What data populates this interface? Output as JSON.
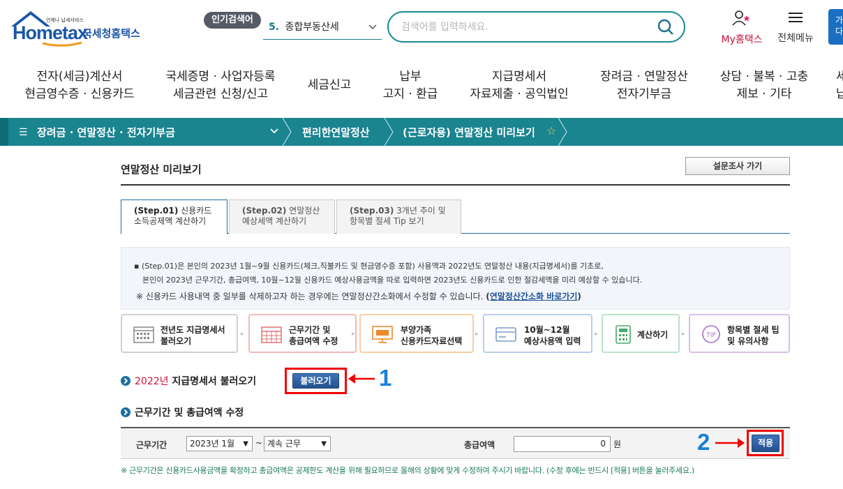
{
  "header": {
    "logo_small": "언제나 납세서비스",
    "logo_brand": "Hometax",
    "logo_kname": "국세청홈택스",
    "popular_badge": "인기검색어",
    "popular_num": "5.",
    "popular_text": "종합부동산세",
    "search_placeholder": "검색어를 입력하세요.",
    "my_hometax": "My홈택스",
    "all_menu": "전체메뉴",
    "right_btn_l1": "가",
    "right_btn_l2": "다"
  },
  "gnb": [
    {
      "l1": "전자(세금)계산서",
      "l2": "현금영수증 · 신용카드"
    },
    {
      "l1": "국세증명 · 사업자등록",
      "l2": "세금관련 신청/신고"
    },
    {
      "l1": "세금신고",
      "l2": ""
    },
    {
      "l1": "납부",
      "l2": "고지 · 환급"
    },
    {
      "l1": "지급명세서",
      "l2": "자료제출 · 공익법인"
    },
    {
      "l1": "장려금 · 연말정산",
      "l2": "전자기부금"
    },
    {
      "l1": "상담 · 불복 · 고충",
      "l2": "제보 · 기타"
    },
    {
      "l1": "세",
      "l2": "납"
    }
  ],
  "breadcrumb": {
    "level1": "장려금 · 연말정산 · 전자기부금",
    "level2": "편리한연말정산",
    "level3": "(근로자용) 연말정산 미리보기"
  },
  "page": {
    "title": "연말정산 미리보기",
    "survey_button": "설문조사 가기"
  },
  "tabs": [
    {
      "step": "(Step.01)",
      "l1": "신용카드",
      "l2": "소득공제액 계산하기"
    },
    {
      "step": "(Step.02)",
      "l1": "연말정산",
      "l2": "예상세액 계산하기"
    },
    {
      "step": "(Step.03)",
      "l1": "3개년 추이 및",
      "l2": "항목별 절세 Tip 보기"
    }
  ],
  "info": {
    "line1": "▪ (Step.01)은 본인의 2023년 1월~9월 신용카드(체크,직불카드 및 현금영수증 포함) 사용액과 2022년도 연말정산 내용(지급명세서)를 기초로,",
    "line2": "본인이 2023년 근무기간, 총급여액, 10월~12월 신용카드 예상사용금액을 따로 입력하면 2023년도 신용카드로 인한 절감세액을 미리 예상할 수 있습니다.",
    "line3": "※ 신용카드 사용내역 중 일부를 삭제하고자 하는 경우에는 연말정산간소화에서 수정할 수 있습니다.",
    "paren_open": "(",
    "link": "연말정산간소화 바로가기",
    "paren_close": ")"
  },
  "steps": [
    {
      "l1": "전년도 지급명세서",
      "l2": "불러오기",
      "color": "#cfcfcf"
    },
    {
      "l1": "근무기간 및",
      "l2": "총급여액 수정",
      "color": "#f2b8b8"
    },
    {
      "l1": "부양가족",
      "l2": "신용카드자료선택",
      "color": "#f7cfa0"
    },
    {
      "l1": "10월~12월",
      "l2": "예상사용액 입력",
      "color": "#b9cde8"
    },
    {
      "l1": "계산하기",
      "l2": "",
      "color": "#b8e2c7"
    },
    {
      "l1": "항목별 절세 팁",
      "l2": "및 유의사항",
      "color": "#d9bfe8"
    }
  ],
  "section1": {
    "year": "2022년",
    "title": "지급명세서 불러오기",
    "button": "불러오기",
    "annotation": "1"
  },
  "section2": {
    "title": "근무기간 및 총급여액 수정",
    "period_label": "근무기간",
    "start": "2023년 1월",
    "tilde": "~",
    "end": "계속 근무",
    "salary_label": "총급여액",
    "salary_value": "0",
    "won": "원",
    "apply_button": "적용",
    "annotation": "2"
  },
  "note": "※ 근무기간은 신용카드사용금액을 확정하고 총급여액은 공제한도 계산을 위해 필요하므로 올해의 상황에 맞게 수정하여 주시기 바랍니다. (수정 후에는 반드시 [적용] 버튼을 눌러주세요.)",
  "colors": {
    "teal": "#1a848f",
    "brand_blue": "#1b56a8",
    "annotation_red": "#ee0000",
    "annotation_blue": "#1a7ed8"
  }
}
